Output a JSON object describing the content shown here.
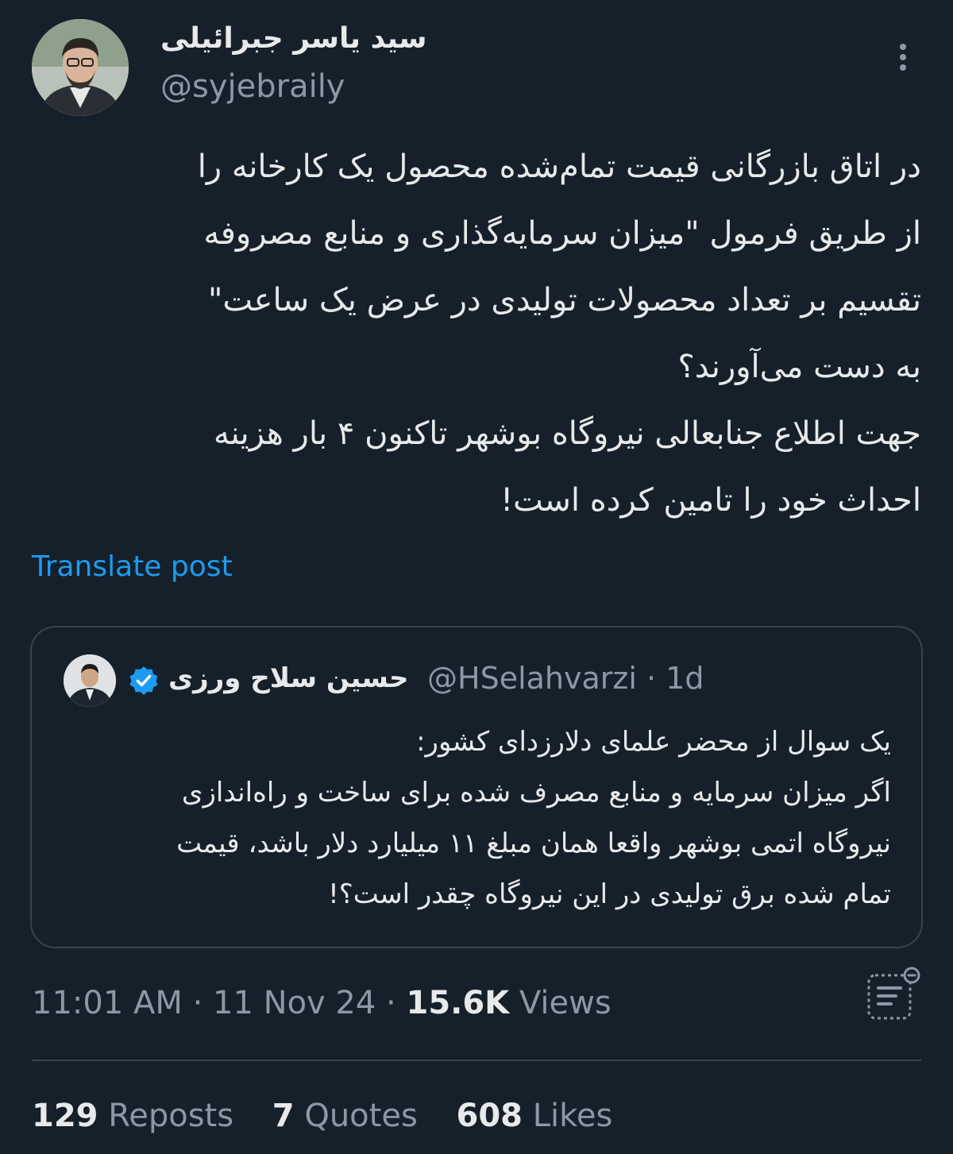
{
  "author": {
    "display_name": "سید یاسر جبرائیلی",
    "handle": "@syjebraily"
  },
  "tweet": {
    "text": "در اتاق بازرگانی قیمت تمام‌شده محصول یک کارخانه را\nاز طریق فرمول \"میزان سرمایه‌گذاری و منابع مصروفه\nتقسیم بر تعداد محصولات تولیدی در عرض یک ساعت\"\nبه دست می‌آورند؟\nجهت اطلاع جنابعالی نیروگاه بوشهر تاکنون ۴ بار هزینه\nاحداث خود را تامین کرده است!",
    "translate_label": "Translate post"
  },
  "quote": {
    "display_name": "حسین سلاح ورزی",
    "handle": "@HSelahvarzi",
    "separator": "·",
    "age": "1d",
    "text": "یک سوال از محضر علمای دلارزدای کشور:\nاگر میزان سرمایه و منابع مصرف شده برای ساخت و راه‌اندازی\nنیروگاه اتمی بوشهر واقعا همان مبلغ ۱۱ میلیارد دلار باشد، قیمت\nتمام شده برق تولیدی در این نیروگاه چقدر است؟!"
  },
  "meta": {
    "time": "11:01 AM",
    "sep1": "·",
    "date": "11 Nov 24",
    "sep2": "·",
    "views_count": "15.6K",
    "views_label": "Views"
  },
  "stats": {
    "reposts_count": "129",
    "reposts_label": "Reposts",
    "quotes_count": "7",
    "quotes_label": "Quotes",
    "likes_count": "608",
    "likes_label": "Likes"
  },
  "icons": {
    "more": "more-vertical-icon",
    "verified": "verified-badge-icon",
    "analytics": "bookmark-analytics-icon"
  },
  "colors": {
    "background": "#15202b",
    "text": "#e7e9ea",
    "muted": "#8b98a5",
    "accent": "#1d9bf0",
    "border": "#38444d"
  }
}
